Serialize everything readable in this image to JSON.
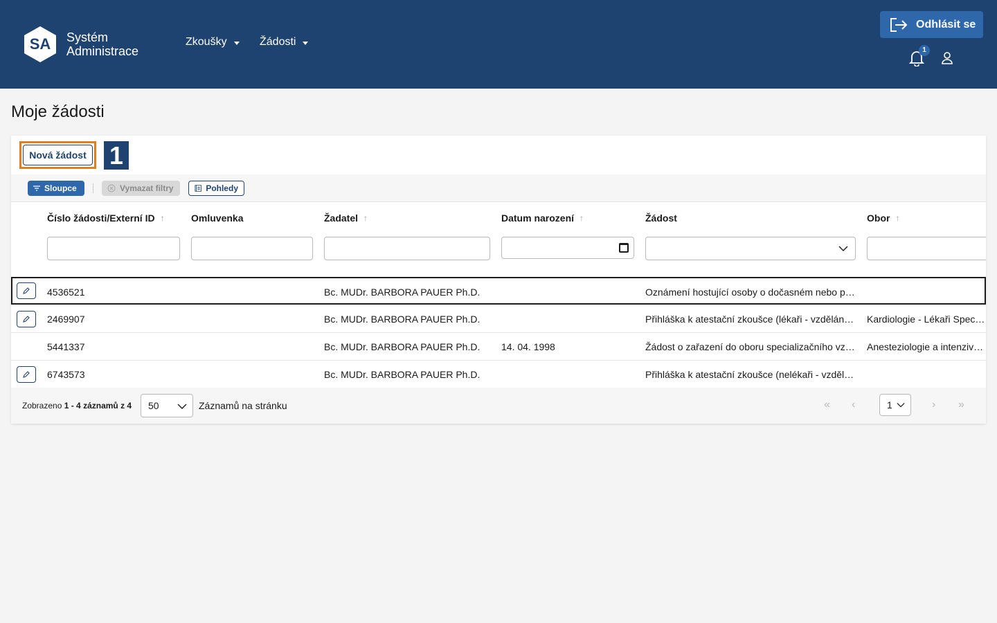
{
  "header": {
    "logo_text": "SA",
    "brand_line1": "Systém",
    "brand_line2": "Administrace",
    "nav": [
      {
        "label": "Zkoušky"
      },
      {
        "label": "Žádosti"
      }
    ],
    "logout_label": "Odhlásit se",
    "notification_count": "1"
  },
  "page": {
    "title": "Moje žádosti",
    "new_button": "Nová žádost",
    "step_marker": "1"
  },
  "toolbar": {
    "columns": "Sloupce",
    "clear_filters": "Vymazat filtry",
    "views": "Pohledy"
  },
  "table": {
    "columns": [
      {
        "label": "Číslo žádosti/Externí ID",
        "sortable": true
      },
      {
        "label": "Omluvenka",
        "sortable": false
      },
      {
        "label": "Žadatel",
        "sortable": true
      },
      {
        "label": "Datum narození",
        "sortable": true
      },
      {
        "label": "Žádost",
        "sortable": false
      },
      {
        "label": "Obor",
        "sortable": true
      }
    ],
    "sort_glyph": "↑",
    "rows": [
      {
        "id": "4536521",
        "excuse": "",
        "applicant": "Bc. MUDr. BARBORA PAUER Ph.D.",
        "birth": "",
        "request": "Oznámení hostující osoby o dočasném nebo pří…",
        "field": "",
        "editable": true
      },
      {
        "id": "2469907",
        "excuse": "",
        "applicant": "Bc. MUDr. BARBORA PAUER Ph.D.",
        "birth": "",
        "request": "Přihláška k atestační zkoušce (lékaři - vzdělání …",
        "field": "Kardiologie - Lékaři Speciali",
        "editable": true
      },
      {
        "id": "5441337",
        "excuse": "",
        "applicant": "Bc. MUDr. BARBORA PAUER Ph.D.",
        "birth": "14. 04. 1998",
        "request": "Žádost o zařazení do oboru specializačního vz…",
        "field": "Anesteziologie a intenzivní m",
        "editable": false
      },
      {
        "id": "6743573",
        "excuse": "",
        "applicant": "Bc. MUDr. BARBORA PAUER Ph.D.",
        "birth": "",
        "request": "Přihláška k atestační zkoušce (nelékaři - vzdělá…",
        "field": "",
        "editable": true
      }
    ]
  },
  "pager": {
    "info_prefix": "Zobrazeno",
    "info_range": "1 - 4 záznamů z 4",
    "per_page": "50",
    "per_page_label": "Záznamů na stránku",
    "current_page": "1",
    "first": "«",
    "prev": "‹",
    "next": "›",
    "last": "»"
  },
  "colors": {
    "header_bg": "#1f4370",
    "accent": "#2e68ab",
    "highlight": "#e07f1d"
  }
}
